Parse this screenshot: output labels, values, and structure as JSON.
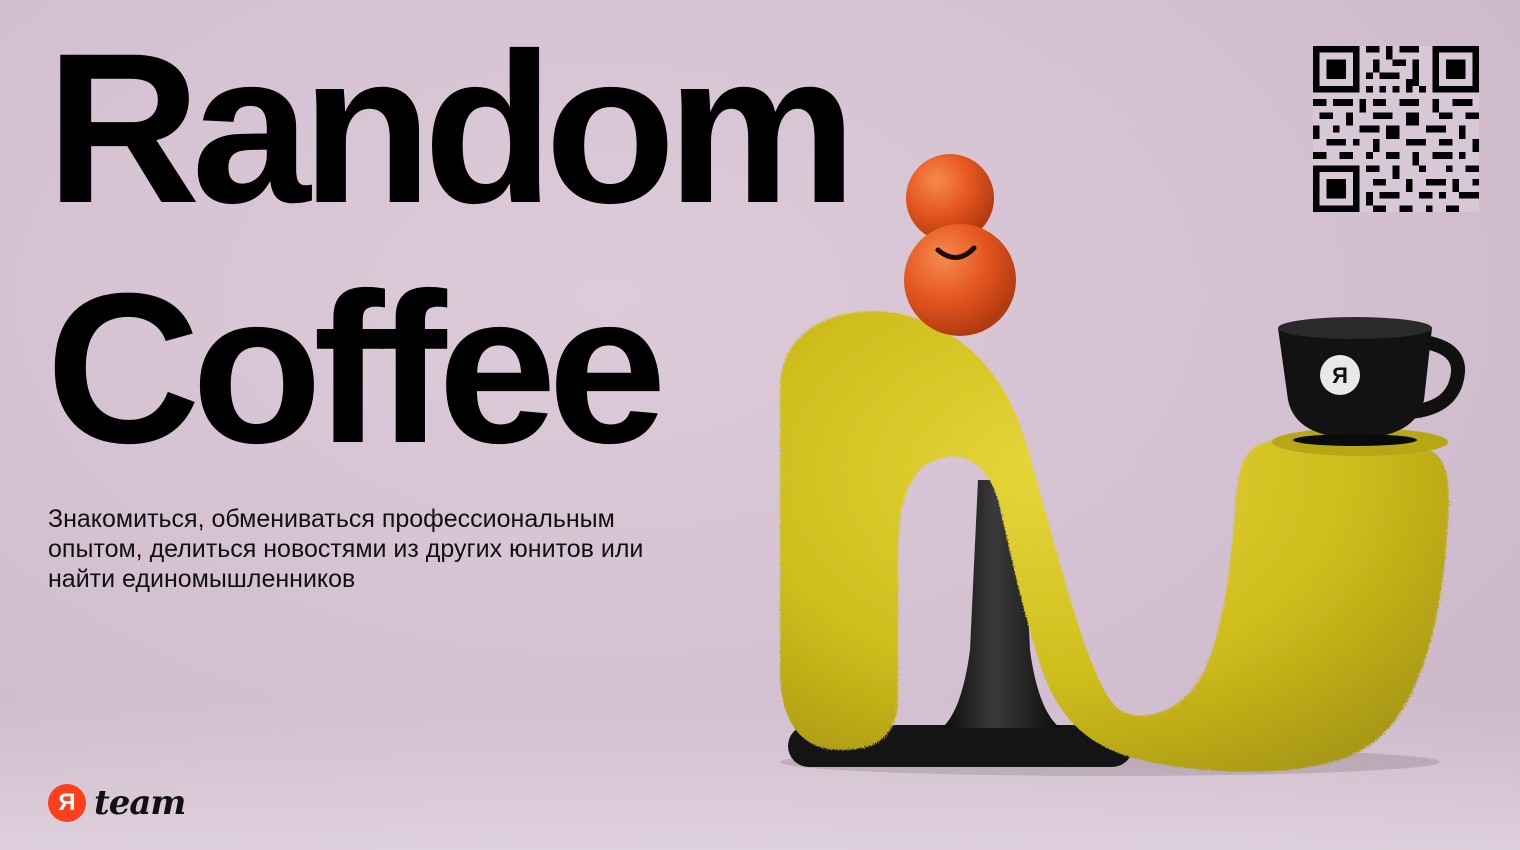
{
  "poster": {
    "title_line1": "Random",
    "title_line2": "Coffee",
    "description": "Знакомиться, обмениваться профессиональным опытом, делиться новостями из других юнитов или найти единомышленников"
  },
  "brand": {
    "badge_letter": "Я",
    "wordmark": "team",
    "badge_color": "#fc3f1d"
  },
  "illustration": {
    "cup_letter": "Я",
    "figure_color": "#d4c21e",
    "ball_color": "#e8582a",
    "base_color": "#1a1a1a"
  },
  "qr_code": {
    "icon": "qr-code-icon"
  }
}
